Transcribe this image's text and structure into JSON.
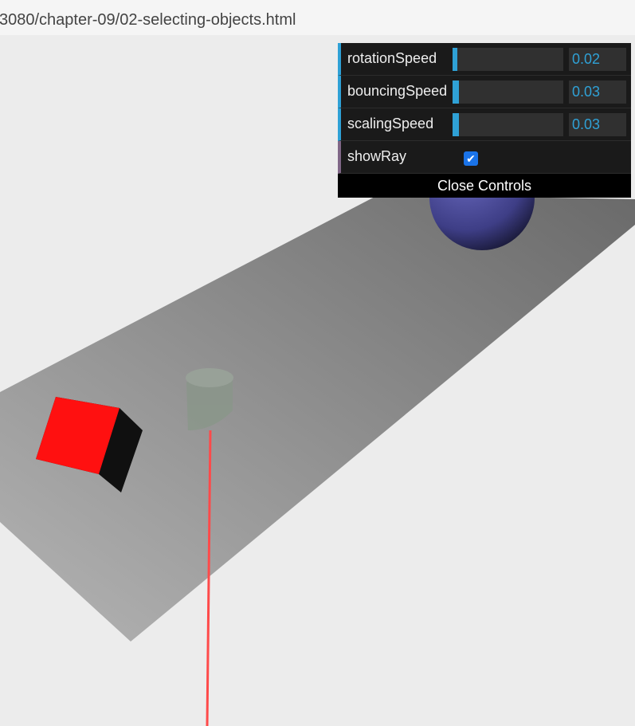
{
  "browser": {
    "url_fragment": "3080/chapter-09/02-selecting-objects.html"
  },
  "gui": {
    "controls": [
      {
        "label": "rotationSpeed",
        "value": "0.02",
        "fraction": 0.02
      },
      {
        "label": "bouncingSpeed",
        "value": "0.03",
        "fraction": 0.03
      },
      {
        "label": "scalingSpeed",
        "value": "0.03",
        "fraction": 0.03
      }
    ],
    "show_ray": {
      "label": "showRay",
      "checked": true
    },
    "close_label": "Close Controls"
  },
  "scene": {
    "colors": {
      "background": "#ececec",
      "plane": "#9a9a9a",
      "cube": "#ff0000",
      "sphere": "#4a4a9a",
      "cylinder": "#6b7a6b",
      "ray": "#ff4444"
    },
    "icons": [
      "checkbox-checked-icon"
    ]
  }
}
